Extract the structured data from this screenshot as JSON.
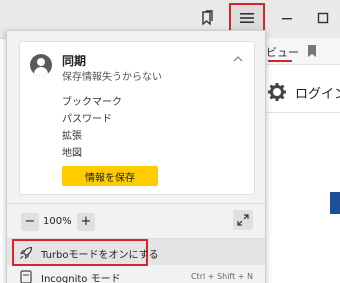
{
  "colors": {
    "accent_red": "#d9232d",
    "save_yellow": "#ffcc00",
    "menu_bg": "#f2f2f2",
    "topbar_bg": "#e9e9e9"
  },
  "toolbar": {
    "bookmark_icon": "bookmarks-icon",
    "menu_icon": "hamburger-menu-icon",
    "minimize_icon": "minimize-icon",
    "maximize_icon": "maximize-icon"
  },
  "background_page": {
    "tab_text": "ビュー",
    "login_label": "ログイン"
  },
  "menu": {
    "sync": {
      "title": "同期",
      "subtitle": "保存情報失うからない",
      "items": [
        "ブックマーク",
        "パスワード",
        "拡張",
        "地図"
      ],
      "save_button": "情報を保存"
    },
    "zoom": {
      "minus": "−",
      "value": "100%",
      "plus": "+"
    },
    "turbo": {
      "label": "Turboモードをオンにする"
    },
    "incognito": {
      "label": "Incognito モード",
      "shortcut": "Ctrl + Shift + N"
    }
  }
}
